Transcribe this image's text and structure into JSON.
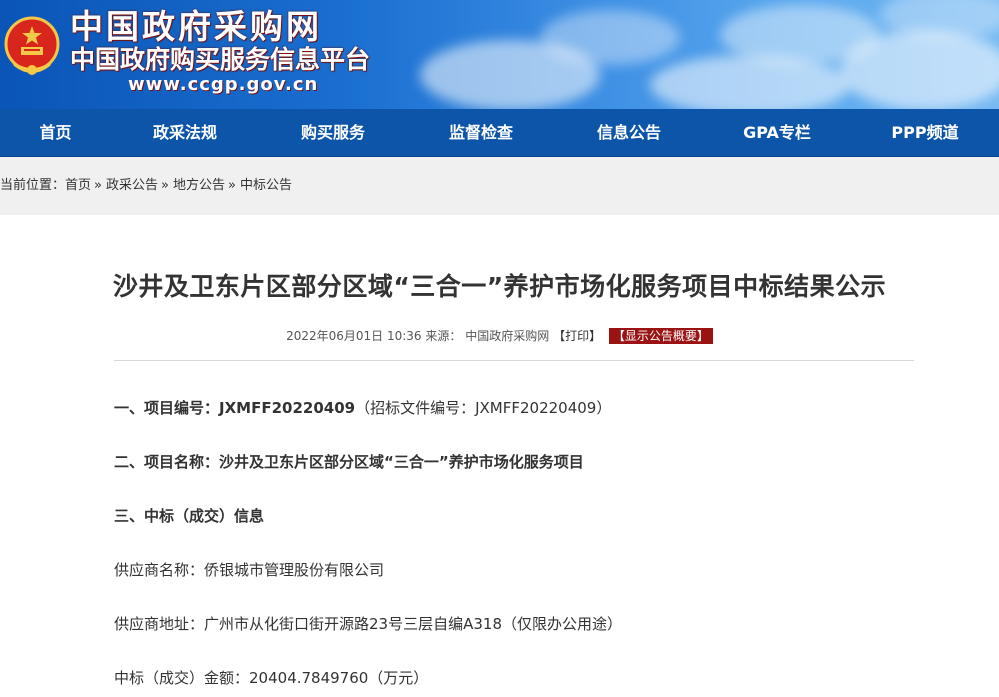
{
  "site": {
    "title": "中国政府采购网",
    "subtitle": "中国政府购买服务信息平台",
    "url": "www.ccgp.gov.cn"
  },
  "nav": {
    "items": [
      {
        "label": "首页"
      },
      {
        "label": "政采法规"
      },
      {
        "label": "购买服务"
      },
      {
        "label": "监督检查"
      },
      {
        "label": "信息公告"
      },
      {
        "label": "GPA专栏"
      },
      {
        "label": "PPP频道"
      }
    ]
  },
  "breadcrumb": {
    "prefix": "当前位置：",
    "items": [
      "首页",
      "政采公告",
      "地方公告",
      "中标公告"
    ],
    "sep": "»"
  },
  "article": {
    "title": "沙井及卫东片区部分区域“三合一”养护市场化服务项目中标结果公示",
    "meta": {
      "datetime": "2022年06月01日 10:36",
      "source_label": "来源：",
      "source": "中国政府采购网",
      "print": "【打印】",
      "summary": "【显示公告概要】"
    },
    "sections": {
      "s1_label": "一、项目编号：",
      "s1_value": "JXMFF20220409",
      "s1_note": "（招标文件编号：JXMFF20220409）",
      "s2_label": "二、项目名称：",
      "s2_value": "沙井及卫东片区部分区域“三合一”养护市场化服务项目",
      "s3_label": "三、中标（成交）信息",
      "supplier_name_label": "供应商名称：",
      "supplier_name": "侨银城市管理股份有限公司",
      "supplier_addr_label": "供应商地址：",
      "supplier_addr": "广州市从化街口街开源路23号三层自编A318（仅限办公用途）",
      "amount_label": "中标（成交）金额：",
      "amount": "20404.7849760（万元）"
    }
  },
  "colors": {
    "nav_bg": "#0d55a8",
    "banner_start": "#0a55b7",
    "accent_red": "#9b1212",
    "crumb_bg": "#f0f0f0"
  }
}
